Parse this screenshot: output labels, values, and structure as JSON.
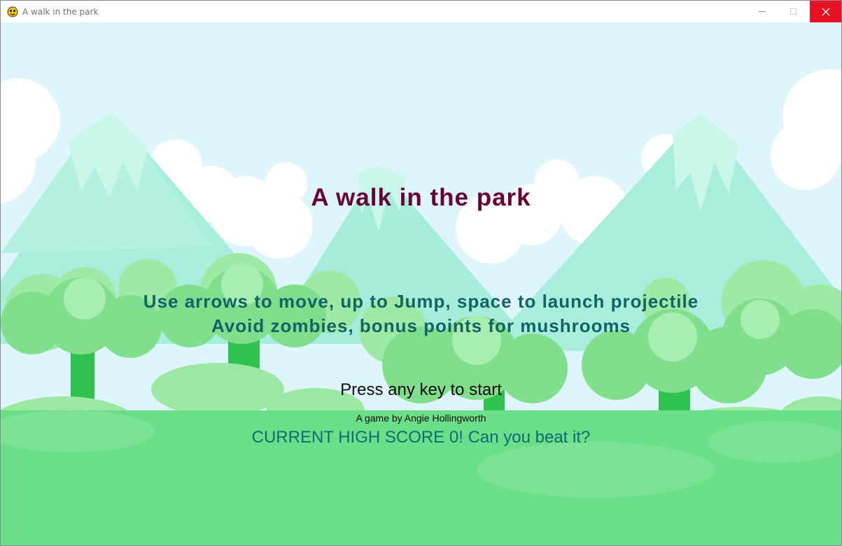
{
  "window": {
    "title": "A walk in the park",
    "app_icon": "python-snake-icon",
    "controls": [
      "minimize-icon",
      "maximize-icon",
      "close-icon"
    ],
    "close_hover_color": "#e81123"
  },
  "game": {
    "title": "A walk in the park",
    "instructions": [
      "Use arrows to move, up to Jump, space to launch projectile",
      "Avoid zombies, bonus points for mushrooms"
    ],
    "start_prompt": "Press any key to start",
    "credit": "A game by Angie Hollingworth",
    "high_score": "CURRENT HIGH SCORE 0! Can you beat it?"
  },
  "colors": {
    "sky": "#def6fb",
    "title": "#6a0136",
    "instructions": "#116366",
    "high_score": "#0e6d70",
    "grass": "#6ade88"
  }
}
